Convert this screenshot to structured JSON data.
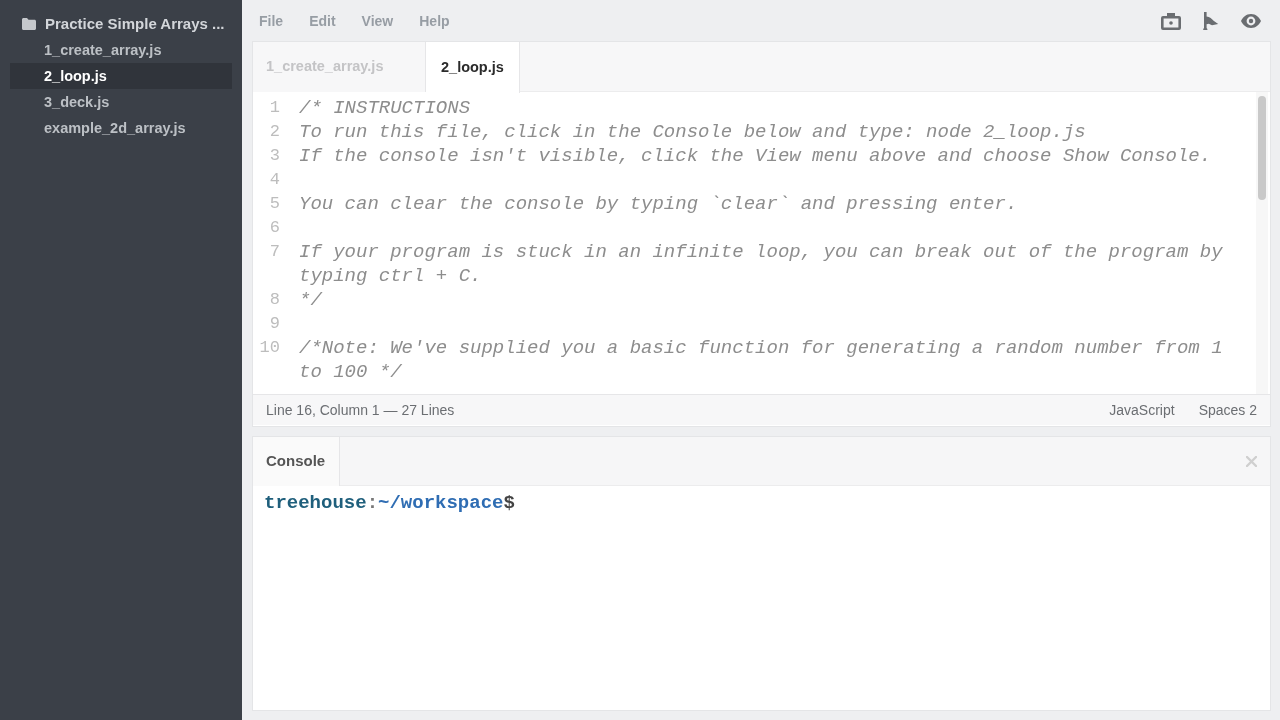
{
  "sidebar": {
    "folder": "Practice Simple Arrays ...",
    "files": [
      {
        "name": "1_create_array.js",
        "selected": false
      },
      {
        "name": "2_loop.js",
        "selected": true
      },
      {
        "name": "3_deck.js",
        "selected": false
      },
      {
        "name": "example_2d_array.js",
        "selected": false
      }
    ]
  },
  "menu": [
    "File",
    "Edit",
    "View",
    "Help"
  ],
  "editor": {
    "tabs": [
      {
        "label": "1_create_array.js",
        "selected": false
      },
      {
        "label": "2_loop.js",
        "selected": true
      }
    ],
    "lines": [
      {
        "number": "1",
        "text": "/* INSTRUCTIONS"
      },
      {
        "number": "2",
        "text": "To run this file, click in the Console below and type: node 2_loop.js"
      },
      {
        "number": "3",
        "text": "If the console isn't visible, click the View menu above and choose Show Console."
      },
      {
        "number": "4"
      },
      {
        "number": "5",
        "text": "You can clear the console by typing `clear` and pressing enter."
      },
      {
        "number": "6"
      },
      {
        "number": "7",
        "text": "If your program is stuck in an infinite loop, you can break out of the program by typing ctrl + C."
      },
      {
        "number": "8",
        "text": "*/"
      },
      {
        "number": "9"
      },
      {
        "number": "10",
        "text": "/*Note: We've supplied you a basic function for generating a random number from 1 to 100 */"
      }
    ],
    "status": {
      "position": "Line 16, Column 1 — 27 Lines",
      "language": "JavaScript",
      "indent": "Spaces 2"
    }
  },
  "console": {
    "tab": "Console",
    "prompt": {
      "user": "treehouse",
      "separator": ":",
      "path": "~/workspace",
      "symbol": "$"
    }
  }
}
